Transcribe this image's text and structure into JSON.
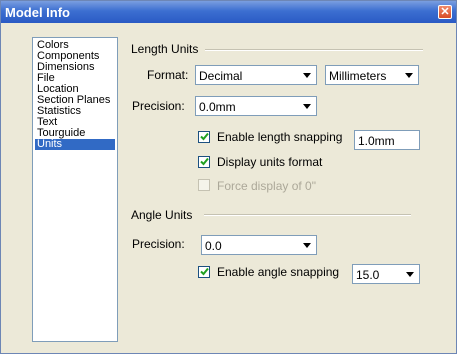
{
  "window": {
    "title": "Model Info"
  },
  "list": {
    "items": [
      "Colors",
      "Components",
      "Dimensions",
      "File",
      "Location",
      "Section Planes",
      "Statistics",
      "Text",
      "Tourguide",
      "Units"
    ],
    "selected": "Units"
  },
  "length_units": {
    "group_title": "Length Units",
    "format_label": "Format:",
    "format_value": "Decimal",
    "unit_value": "Millimeters",
    "precision_label": "Precision:",
    "precision_value": "0.0mm",
    "enable_snapping_label": "Enable length snapping",
    "enable_snapping_checked": true,
    "snapping_value": "1.0mm",
    "display_units_label": "Display units format",
    "display_units_checked": true,
    "force_display_label": "Force display of 0\"",
    "force_display_checked": false
  },
  "angle_units": {
    "group_title": "Angle Units",
    "precision_label": "Precision:",
    "precision_value": "0.0",
    "enable_snapping_label": "Enable angle snapping",
    "enable_snapping_checked": true,
    "snapping_value": "15.0"
  }
}
